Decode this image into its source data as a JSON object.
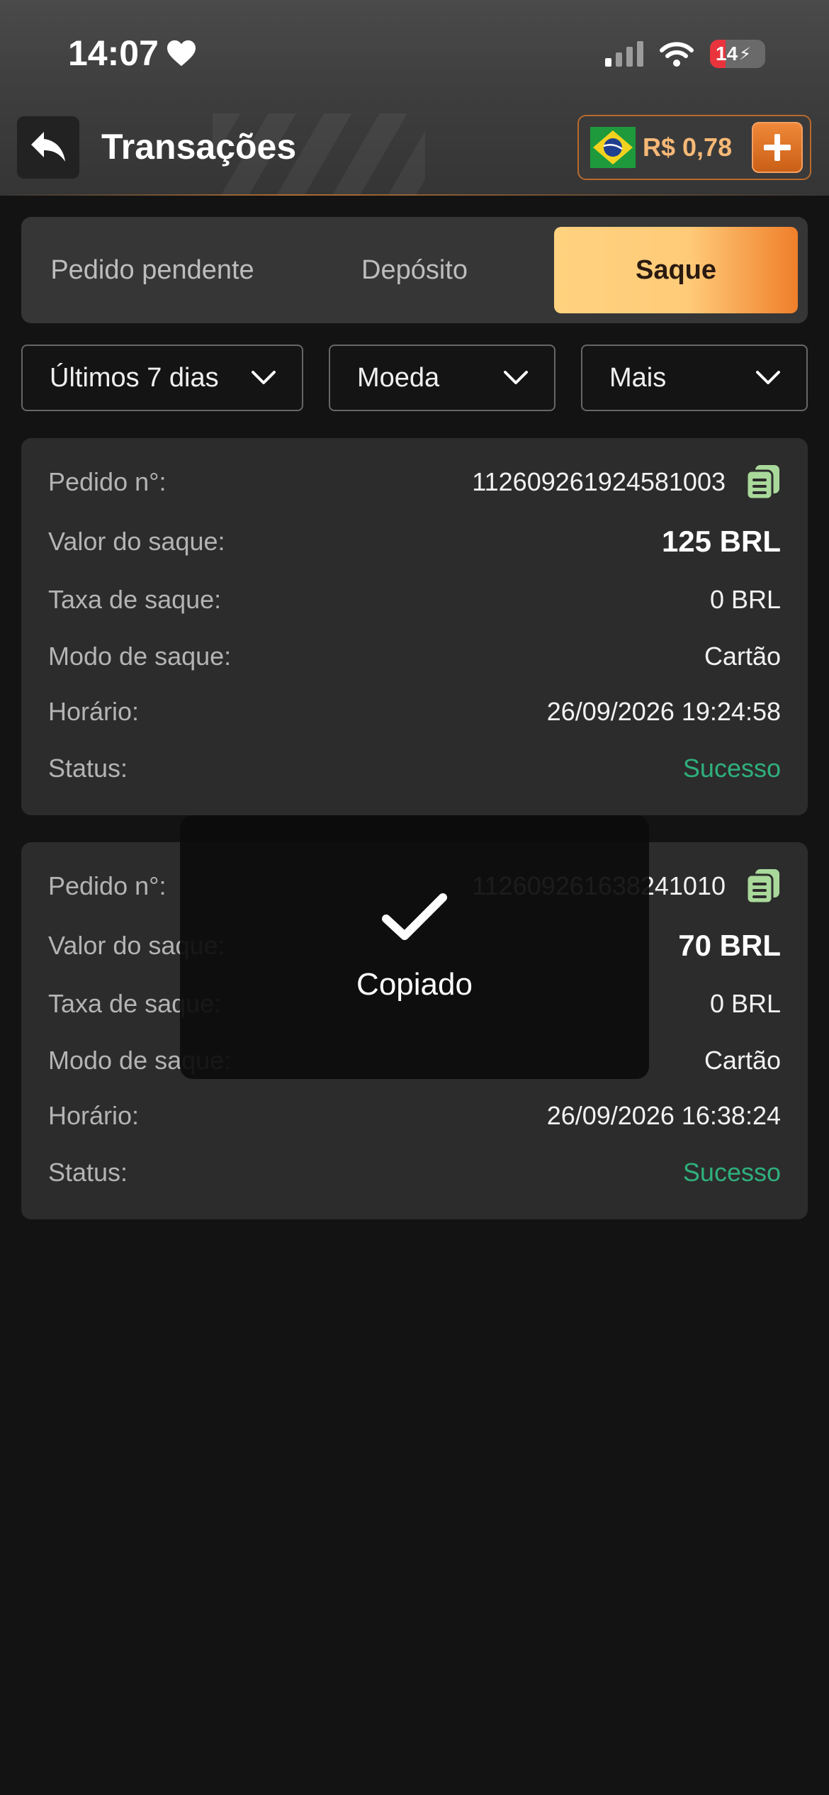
{
  "status_bar": {
    "time": "14:07",
    "battery": "14"
  },
  "header": {
    "title": "Transações",
    "balance": "R$ 0,78"
  },
  "tabs": [
    {
      "label": "Pedido pendente",
      "active": false
    },
    {
      "label": "Depósito",
      "active": false
    },
    {
      "label": "Saque",
      "active": true
    }
  ],
  "filters": {
    "days": "Últimos 7 dias",
    "currency": "Moeda",
    "more": "Mais"
  },
  "labels": {
    "order": "Pedido n°:",
    "amount": "Valor do saque:",
    "fee": "Taxa de saque:",
    "mode": "Modo de saque:",
    "time": "Horário:",
    "status": "Status:"
  },
  "transactions": [
    {
      "order_id": "112609261924581003",
      "amount": "125 BRL",
      "fee": "0 BRL",
      "mode": "Cartão",
      "time": "26/09/2026 19:24:58",
      "status": "Sucesso"
    },
    {
      "order_id": "112609261638241010",
      "amount": "70 BRL",
      "fee": "0 BRL",
      "mode": "Cartão",
      "time": "26/09/2026 16:38:24",
      "status": "Sucesso"
    }
  ],
  "toast": {
    "text": "Copiado"
  },
  "colors": {
    "accent": "#f08a3a",
    "success": "#2fb07d",
    "copy_icon": "#a9d99a"
  }
}
